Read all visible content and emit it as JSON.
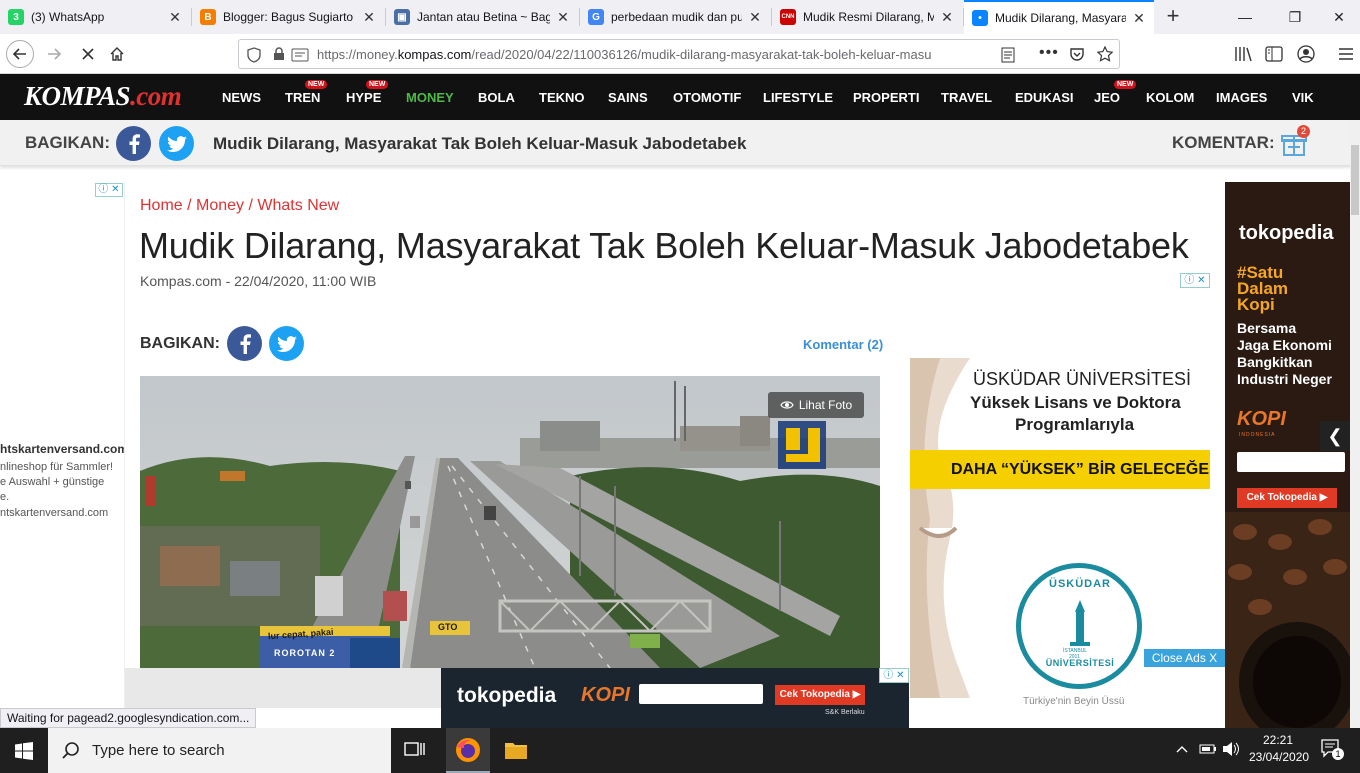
{
  "browser": {
    "tabs": [
      {
        "title": "(3) WhatsApp",
        "icon": "whatsapp-icon",
        "color": "#25d366",
        "glyph": "3"
      },
      {
        "title": "Blogger: Bagus Sugiarto",
        "icon": "blogger-icon",
        "color": "#f57d00",
        "glyph": "B"
      },
      {
        "title": "Jantan atau Betina ~ Bagu",
        "icon": "page-icon",
        "color": "#4a6fa5",
        "glyph": "▣"
      },
      {
        "title": "perbedaan mudik dan pul",
        "icon": "google-icon",
        "color": "#4285f4",
        "glyph": "G"
      },
      {
        "title": "Mudik Resmi Dilarang, M",
        "icon": "cnn-icon",
        "color": "#cc0000",
        "glyph": "CNN"
      },
      {
        "title": "Mudik Dilarang, Masyara",
        "icon": "loading-icon",
        "color": "#0a84ff",
        "glyph": "•"
      }
    ],
    "new_tab": "+",
    "url_prefix": "https://money.",
    "url_domain": "kompas.com",
    "url_rest": "/read/2020/04/22/110036126/mudik-dilarang-masyarakat-tak-boleh-keluar-masu",
    "status_text": "Waiting for pagead2.googlesyndication.com..."
  },
  "site": {
    "logo_main": "KOMPAS",
    "logo_suffix": ".com",
    "menu": [
      {
        "label": "NEWS",
        "badge": ""
      },
      {
        "label": "TREN",
        "badge": "NEW"
      },
      {
        "label": "HYPE",
        "badge": "NEW"
      },
      {
        "label": "MONEY",
        "badge": "",
        "active": true
      },
      {
        "label": "BOLA",
        "badge": ""
      },
      {
        "label": "TEKNO",
        "badge": ""
      },
      {
        "label": "SAINS",
        "badge": ""
      },
      {
        "label": "OTOMOTIF",
        "badge": ""
      },
      {
        "label": "LIFESTYLE",
        "badge": ""
      },
      {
        "label": "PROPERTI",
        "badge": ""
      },
      {
        "label": "TRAVEL",
        "badge": ""
      },
      {
        "label": "EDUKASI",
        "badge": ""
      },
      {
        "label": "JEO",
        "badge": "NEW"
      },
      {
        "label": "KOLOM",
        "badge": ""
      },
      {
        "label": "IMAGES",
        "badge": ""
      },
      {
        "label": "VIK",
        "badge": ""
      }
    ],
    "accent_active": "#4fb848",
    "badge_color": "#d0121b"
  },
  "sharebar": {
    "label": "BAGIKAN:",
    "title": "Mudik Dilarang, Masyarakat Tak Boleh Keluar-Masuk Jabodetabek",
    "komentar_label": "KOMENTAR:",
    "gift_count": "2"
  },
  "article": {
    "breadcrumb": [
      "Home",
      "Money",
      "Whats New"
    ],
    "breadcrumb_sep": " / ",
    "title": "Mudik Dilarang, Masyarakat Tak Boleh Keluar-Masuk Jabodetabek",
    "meta": "Kompas.com - 22/04/2020, 11:00 WIB",
    "share_label": "BAGIKAN:",
    "komentar": "Komentar (2)",
    "photo_button": "Lihat Foto",
    "photo_signs": {
      "left": "ROROTAN 2",
      "right": "GTO",
      "banner": "lur cepat, pakai"
    }
  },
  "ads": {
    "left": {
      "domain": "htskartenversand.com",
      "lines": [
        "nlineshop für Sammler!",
        "e Auswahl + günstige",
        "e."
      ],
      "domain2": "ntskartenversand.com"
    },
    "right": {
      "brand": "tokopedia",
      "headline": [
        "#Satu",
        "Dalam",
        "Kopi"
      ],
      "sub": [
        "Bersama",
        "Jaga Ekonomi",
        "Bangkitkan",
        "Industri Neger"
      ],
      "cta": "Cek Tokopedia ▶",
      "kopi": "KOPI",
      "kopi_sub": "INDONESIA"
    },
    "center": {
      "title": "ÜSKÜDAR ÜNİVERSİTESİ",
      "subtitle1": "Yüksek Lisans ve Doktora",
      "subtitle2": "Programlarıyla",
      "banner": "DAHA “YÜKSEK” BİR GELECEĞE",
      "seal_top": "ÜSKÜDAR",
      "seal_bottom": "ÜNİVERSİTESİ",
      "seal_city": "İSTANBUL",
      "seal_year": "2011",
      "footer": "Türkiye'nin Beyin Üssü",
      "close": "Close Ads X"
    },
    "bottom": {
      "brand": "tokopedia",
      "kopi": "KOPI",
      "cta": "Cek Tokopedia ▶",
      "small": "S&K Berlaku"
    }
  },
  "taskbar": {
    "search_placeholder": "Type here to search",
    "time": "22:21",
    "date": "23/04/2020",
    "notif_count": "1"
  }
}
